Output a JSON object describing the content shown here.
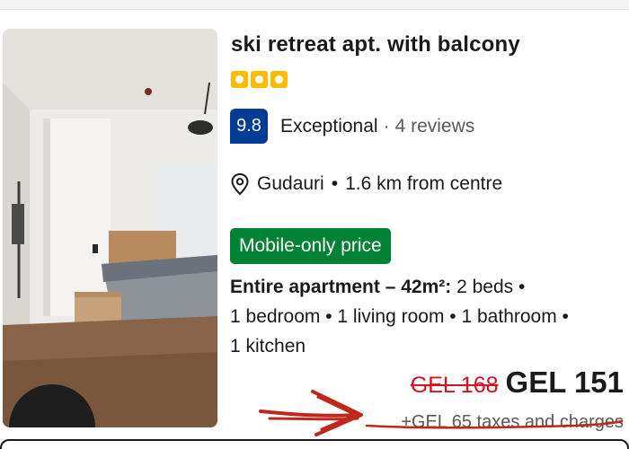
{
  "listing": {
    "title": "ski retreat apt. with balcony",
    "stars": 3,
    "score": "9.8",
    "rating_label": "Exceptional",
    "rating_separator": "·",
    "reviews": "4 reviews",
    "location": "Gudauri",
    "location_separator": "•",
    "distance": "1.6 km from centre",
    "badge": "Mobile-only price",
    "details_strong": "Entire apartment – 42m²:",
    "details_rest_1": " 2 beds •",
    "details_line_2": "1 bedroom • 1 living room • 1 bathroom •",
    "details_line_3": "1 kitchen",
    "old_price": "GEL 168",
    "new_price": "GEL 151",
    "taxes": "+GEL 65 taxes and charges"
  },
  "icons": {
    "location": "map-pin-icon"
  },
  "colors": {
    "score_badge": "#003b95",
    "star": "#febb02",
    "mobile_badge": "#008234",
    "old_price": "#d4111e",
    "annotation": "#c0271b"
  }
}
